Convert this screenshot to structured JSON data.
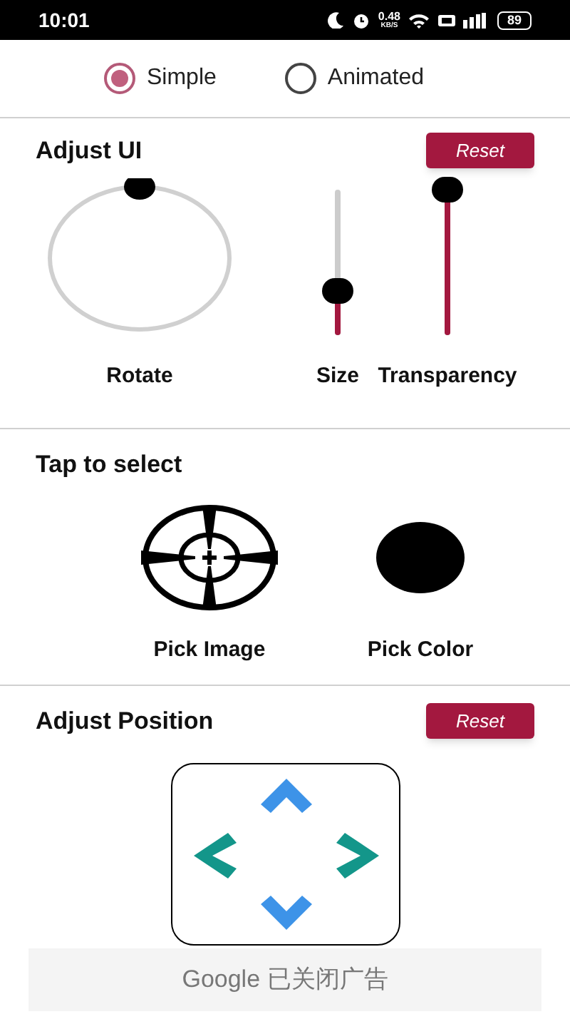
{
  "status_bar": {
    "time": "10:01",
    "speed": "0.48",
    "speed_unit": "KB/S",
    "battery": "89"
  },
  "mode_options": [
    {
      "label": "Simple",
      "selected": true
    },
    {
      "label": "Animated",
      "selected": false
    }
  ],
  "adjust_ui": {
    "title": "Adjust UI",
    "reset_label": "Reset",
    "controls": [
      {
        "kind": "dial",
        "label": "Rotate"
      },
      {
        "kind": "vertical-slider",
        "label": "Size",
        "level": 0.3
      },
      {
        "kind": "vertical-slider",
        "label": "Transparency",
        "level": 1
      }
    ]
  },
  "tap_to_select": {
    "title": "Tap to select",
    "items": [
      {
        "kind": "crosshair",
        "label": "Pick Image"
      },
      {
        "kind": "color",
        "label": "Pick Color",
        "color": "#000000"
      }
    ]
  },
  "adjust_position": {
    "title": "Adjust Position",
    "reset_label": "Reset"
  },
  "ad_bar": {
    "text": "Google 已关闭广告"
  }
}
